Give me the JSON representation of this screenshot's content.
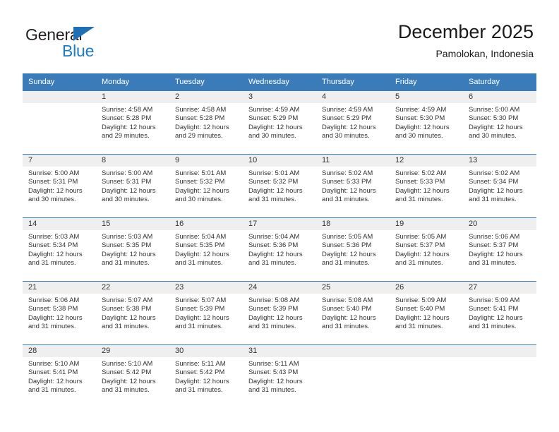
{
  "brand": {
    "name_part1": "General",
    "name_part2": "Blue",
    "triangle_icon": "triangle-icon",
    "primary_color": "#1f7bc1",
    "dark_text_color": "#231f20"
  },
  "header": {
    "title": "December 2025",
    "subtitle": "Pamolokan, Indonesia"
  },
  "theme": {
    "header_blue": "#3a7cb9",
    "daynum_band": "#efefef",
    "cell_background": "#ffffff",
    "text_color": "#333333"
  },
  "weekdays": [
    "Sunday",
    "Monday",
    "Tuesday",
    "Wednesday",
    "Thursday",
    "Friday",
    "Saturday"
  ],
  "labels": {
    "sunrise_prefix": "Sunrise:",
    "sunset_prefix": "Sunset:",
    "daylight_prefix": "Daylight:"
  },
  "weeks": [
    [
      {
        "day": "",
        "sunrise": "",
        "sunset": "",
        "daylight_line1": "",
        "daylight_line2": ""
      },
      {
        "day": "1",
        "sunrise": "Sunrise: 4:58 AM",
        "sunset": "Sunset: 5:28 PM",
        "daylight_line1": "Daylight: 12 hours",
        "daylight_line2": "and 29 minutes."
      },
      {
        "day": "2",
        "sunrise": "Sunrise: 4:58 AM",
        "sunset": "Sunset: 5:28 PM",
        "daylight_line1": "Daylight: 12 hours",
        "daylight_line2": "and 29 minutes."
      },
      {
        "day": "3",
        "sunrise": "Sunrise: 4:59 AM",
        "sunset": "Sunset: 5:29 PM",
        "daylight_line1": "Daylight: 12 hours",
        "daylight_line2": "and 30 minutes."
      },
      {
        "day": "4",
        "sunrise": "Sunrise: 4:59 AM",
        "sunset": "Sunset: 5:29 PM",
        "daylight_line1": "Daylight: 12 hours",
        "daylight_line2": "and 30 minutes."
      },
      {
        "day": "5",
        "sunrise": "Sunrise: 4:59 AM",
        "sunset": "Sunset: 5:30 PM",
        "daylight_line1": "Daylight: 12 hours",
        "daylight_line2": "and 30 minutes."
      },
      {
        "day": "6",
        "sunrise": "Sunrise: 5:00 AM",
        "sunset": "Sunset: 5:30 PM",
        "daylight_line1": "Daylight: 12 hours",
        "daylight_line2": "and 30 minutes."
      }
    ],
    [
      {
        "day": "7",
        "sunrise": "Sunrise: 5:00 AM",
        "sunset": "Sunset: 5:31 PM",
        "daylight_line1": "Daylight: 12 hours",
        "daylight_line2": "and 30 minutes."
      },
      {
        "day": "8",
        "sunrise": "Sunrise: 5:00 AM",
        "sunset": "Sunset: 5:31 PM",
        "daylight_line1": "Daylight: 12 hours",
        "daylight_line2": "and 30 minutes."
      },
      {
        "day": "9",
        "sunrise": "Sunrise: 5:01 AM",
        "sunset": "Sunset: 5:32 PM",
        "daylight_line1": "Daylight: 12 hours",
        "daylight_line2": "and 30 minutes."
      },
      {
        "day": "10",
        "sunrise": "Sunrise: 5:01 AM",
        "sunset": "Sunset: 5:32 PM",
        "daylight_line1": "Daylight: 12 hours",
        "daylight_line2": "and 31 minutes."
      },
      {
        "day": "11",
        "sunrise": "Sunrise: 5:02 AM",
        "sunset": "Sunset: 5:33 PM",
        "daylight_line1": "Daylight: 12 hours",
        "daylight_line2": "and 31 minutes."
      },
      {
        "day": "12",
        "sunrise": "Sunrise: 5:02 AM",
        "sunset": "Sunset: 5:33 PM",
        "daylight_line1": "Daylight: 12 hours",
        "daylight_line2": "and 31 minutes."
      },
      {
        "day": "13",
        "sunrise": "Sunrise: 5:02 AM",
        "sunset": "Sunset: 5:34 PM",
        "daylight_line1": "Daylight: 12 hours",
        "daylight_line2": "and 31 minutes."
      }
    ],
    [
      {
        "day": "14",
        "sunrise": "Sunrise: 5:03 AM",
        "sunset": "Sunset: 5:34 PM",
        "daylight_line1": "Daylight: 12 hours",
        "daylight_line2": "and 31 minutes."
      },
      {
        "day": "15",
        "sunrise": "Sunrise: 5:03 AM",
        "sunset": "Sunset: 5:35 PM",
        "daylight_line1": "Daylight: 12 hours",
        "daylight_line2": "and 31 minutes."
      },
      {
        "day": "16",
        "sunrise": "Sunrise: 5:04 AM",
        "sunset": "Sunset: 5:35 PM",
        "daylight_line1": "Daylight: 12 hours",
        "daylight_line2": "and 31 minutes."
      },
      {
        "day": "17",
        "sunrise": "Sunrise: 5:04 AM",
        "sunset": "Sunset: 5:36 PM",
        "daylight_line1": "Daylight: 12 hours",
        "daylight_line2": "and 31 minutes."
      },
      {
        "day": "18",
        "sunrise": "Sunrise: 5:05 AM",
        "sunset": "Sunset: 5:36 PM",
        "daylight_line1": "Daylight: 12 hours",
        "daylight_line2": "and 31 minutes."
      },
      {
        "day": "19",
        "sunrise": "Sunrise: 5:05 AM",
        "sunset": "Sunset: 5:37 PM",
        "daylight_line1": "Daylight: 12 hours",
        "daylight_line2": "and 31 minutes."
      },
      {
        "day": "20",
        "sunrise": "Sunrise: 5:06 AM",
        "sunset": "Sunset: 5:37 PM",
        "daylight_line1": "Daylight: 12 hours",
        "daylight_line2": "and 31 minutes."
      }
    ],
    [
      {
        "day": "21",
        "sunrise": "Sunrise: 5:06 AM",
        "sunset": "Sunset: 5:38 PM",
        "daylight_line1": "Daylight: 12 hours",
        "daylight_line2": "and 31 minutes."
      },
      {
        "day": "22",
        "sunrise": "Sunrise: 5:07 AM",
        "sunset": "Sunset: 5:38 PM",
        "daylight_line1": "Daylight: 12 hours",
        "daylight_line2": "and 31 minutes."
      },
      {
        "day": "23",
        "sunrise": "Sunrise: 5:07 AM",
        "sunset": "Sunset: 5:39 PM",
        "daylight_line1": "Daylight: 12 hours",
        "daylight_line2": "and 31 minutes."
      },
      {
        "day": "24",
        "sunrise": "Sunrise: 5:08 AM",
        "sunset": "Sunset: 5:39 PM",
        "daylight_line1": "Daylight: 12 hours",
        "daylight_line2": "and 31 minutes."
      },
      {
        "day": "25",
        "sunrise": "Sunrise: 5:08 AM",
        "sunset": "Sunset: 5:40 PM",
        "daylight_line1": "Daylight: 12 hours",
        "daylight_line2": "and 31 minutes."
      },
      {
        "day": "26",
        "sunrise": "Sunrise: 5:09 AM",
        "sunset": "Sunset: 5:40 PM",
        "daylight_line1": "Daylight: 12 hours",
        "daylight_line2": "and 31 minutes."
      },
      {
        "day": "27",
        "sunrise": "Sunrise: 5:09 AM",
        "sunset": "Sunset: 5:41 PM",
        "daylight_line1": "Daylight: 12 hours",
        "daylight_line2": "and 31 minutes."
      }
    ],
    [
      {
        "day": "28",
        "sunrise": "Sunrise: 5:10 AM",
        "sunset": "Sunset: 5:41 PM",
        "daylight_line1": "Daylight: 12 hours",
        "daylight_line2": "and 31 minutes."
      },
      {
        "day": "29",
        "sunrise": "Sunrise: 5:10 AM",
        "sunset": "Sunset: 5:42 PM",
        "daylight_line1": "Daylight: 12 hours",
        "daylight_line2": "and 31 minutes."
      },
      {
        "day": "30",
        "sunrise": "Sunrise: 5:11 AM",
        "sunset": "Sunset: 5:42 PM",
        "daylight_line1": "Daylight: 12 hours",
        "daylight_line2": "and 31 minutes."
      },
      {
        "day": "31",
        "sunrise": "Sunrise: 5:11 AM",
        "sunset": "Sunset: 5:43 PM",
        "daylight_line1": "Daylight: 12 hours",
        "daylight_line2": "and 31 minutes."
      },
      {
        "day": "",
        "sunrise": "",
        "sunset": "",
        "daylight_line1": "",
        "daylight_line2": ""
      },
      {
        "day": "",
        "sunrise": "",
        "sunset": "",
        "daylight_line1": "",
        "daylight_line2": ""
      },
      {
        "day": "",
        "sunrise": "",
        "sunset": "",
        "daylight_line1": "",
        "daylight_line2": ""
      }
    ]
  ]
}
